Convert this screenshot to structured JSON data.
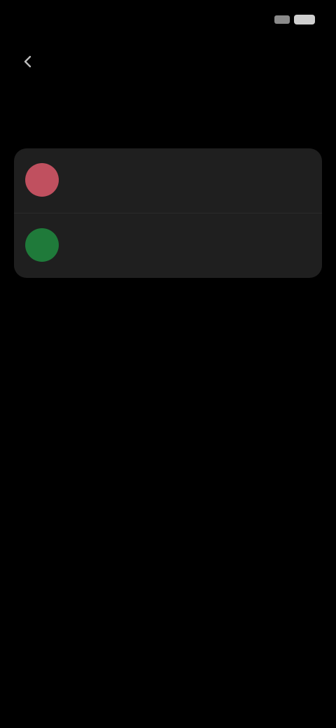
{
  "status_bar": {
    "time": "",
    "icons": [
      "signal-icon",
      "battery-icon"
    ]
  },
  "header": {
    "title": "",
    "back_icon": "arrow-left-icon"
  },
  "description": "",
  "items": [
    {
      "label": "",
      "action": "",
      "avatar_color": "#c0505f"
    },
    {
      "label": "",
      "action": "",
      "avatar_color": "#1f7a3a"
    }
  ],
  "colors": {
    "background": "#000000",
    "card": "#1f1f1f",
    "text": "#d8d8d8",
    "muted": "#8c8c8c"
  }
}
